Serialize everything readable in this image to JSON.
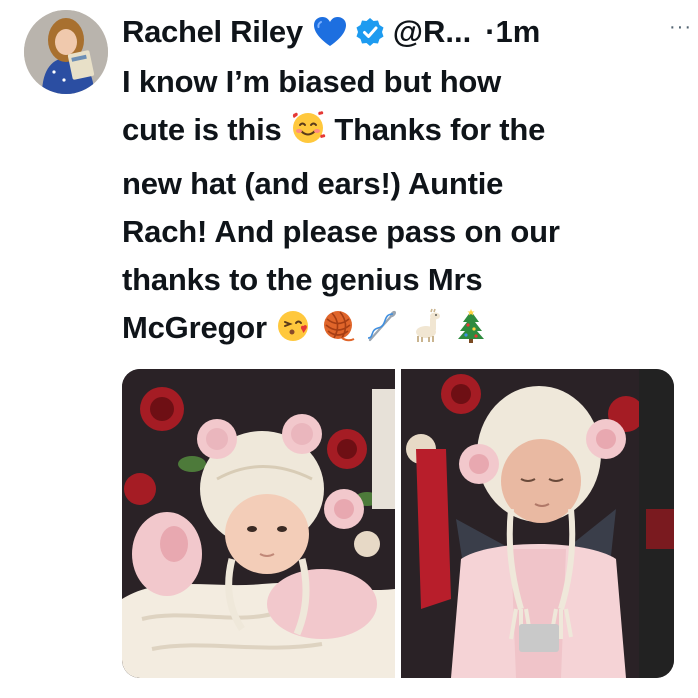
{
  "author": {
    "name": "Rachel Riley",
    "handle": "@R...",
    "time": "·1m",
    "heart_icon": "blue-heart-icon",
    "badge_icon": "verified-badge-icon",
    "accent": "#1d9bf0"
  },
  "more_label": "···",
  "tweet": {
    "lines": [
      "I know I’m biased but how",
      "cute is this",
      "Thanks for the",
      "new hat (and ears!) Auntie",
      "Rach! And please pass on our",
      "thanks to the genius Mrs",
      "McGregor"
    ],
    "emojis": [
      "smiling-face-with-hearts-emoji",
      "face-blowing-kiss-emoji",
      "yarn-emoji",
      "sewing-needle-emoji",
      "llama-emoji",
      "christmas-tree-emoji"
    ]
  },
  "media": {
    "count": 2,
    "photos": [
      "baby-in-cream-bear-hat",
      "baby-in-car-seat"
    ]
  }
}
